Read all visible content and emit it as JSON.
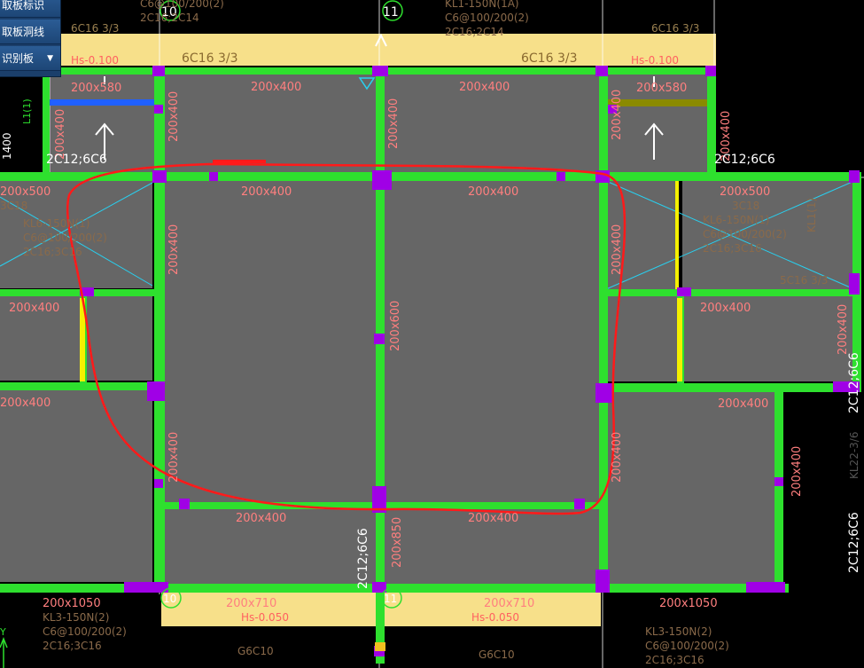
{
  "toolbar": {
    "items": [
      {
        "label": "取板标识"
      },
      {
        "label": "取板洞线"
      },
      {
        "label": "识别板",
        "dropdown": true
      }
    ]
  },
  "axes": {
    "a10": "10",
    "a11": "11",
    "b10": "10",
    "b11": "11",
    "ucs_y": "Y"
  },
  "rebar": {
    "top_left_c": "6C16  3/3",
    "top_mid": "6C16  3/3",
    "top_right_c": "6C16  3/3",
    "hs_left": "Hs-0.100",
    "hs_right": "Hs-0.100",
    "top_kl": "KL1-150N(1A)",
    "top_kl2": "C6@100/200(2)",
    "top_kl3": "2C16;2C14",
    "top_left2": "C6@100/200(2)",
    "top_left3": "2C16;2C14",
    "corner_tl": "2C12;6C6",
    "corner_tr": "2C12;6C6",
    "right_vert": "2C12;6C6",
    "right_vert2": "2C12;6C6",
    "center_vert": "2C12;6C6",
    "kl6_left_1": "KL6-150N(1)",
    "kl6_left_2": "C6@100/200(2)",
    "kl6_left_3": "2C16;3C16",
    "kl6_right_1": "KL6-150N(1)",
    "kl6_right_2": "C6@100/200(2)",
    "kl6_right_3": "2C16;3C16",
    "kl1_right": "KL1(1)",
    "c5_right": "5C16  3/3",
    "kl3_left_1": "KL3-150N(2)",
    "kl3_left_2": "C6@100/200(2)",
    "kl3_left_3": "2C16;3C16",
    "kl3_right_1": "KL3-150N(2)",
    "kl3_right_2": "C6@100/200(2)",
    "kl3_right_3": "2C16;3C16",
    "hs_bot_left": "Hs-0.050",
    "hs_bot_right": "Hs-0.050",
    "g6_left": "G6C10",
    "g6_right": "G6C10",
    "bl_3c18": "3C18",
    "r_3c18": "3C18",
    "left_side": "1400",
    "l1": "L1(1)",
    "right_k": "KL22-3/6"
  },
  "beams": {
    "b1": "200x580",
    "b2": "200x400",
    "b3": "200x400",
    "b4": "200x580",
    "b5": "200x400",
    "b6": "200x400",
    "b7": "200x500",
    "b8": "200x400",
    "b9": "200x400",
    "b10": "200x500",
    "b11": "200x400",
    "b12": "200x600",
    "b13": "200x400",
    "b14": "200x400",
    "b15": "200x400",
    "b16": "200x400",
    "b17": "200x400",
    "b18": "200x400",
    "b19": "200x400",
    "b20": "200x400",
    "b21": "200x400",
    "b22": "200x850",
    "b23": "200x400",
    "b24": "200x1050",
    "b25": "200x710",
    "b26": "200x710",
    "b27": "200x1050",
    "b28": "200x400",
    "b29": "200x400",
    "b30": "200x400",
    "b31": "200x400"
  },
  "colors": {
    "background": "#000000",
    "beam": "#2ee02e",
    "slab": "#666666",
    "column": "#a000e6",
    "highlight": "#ff0000",
    "yellow_band": "#f7e08a",
    "grid_line": "#ffffff",
    "diagonal": "#28d0f0"
  }
}
